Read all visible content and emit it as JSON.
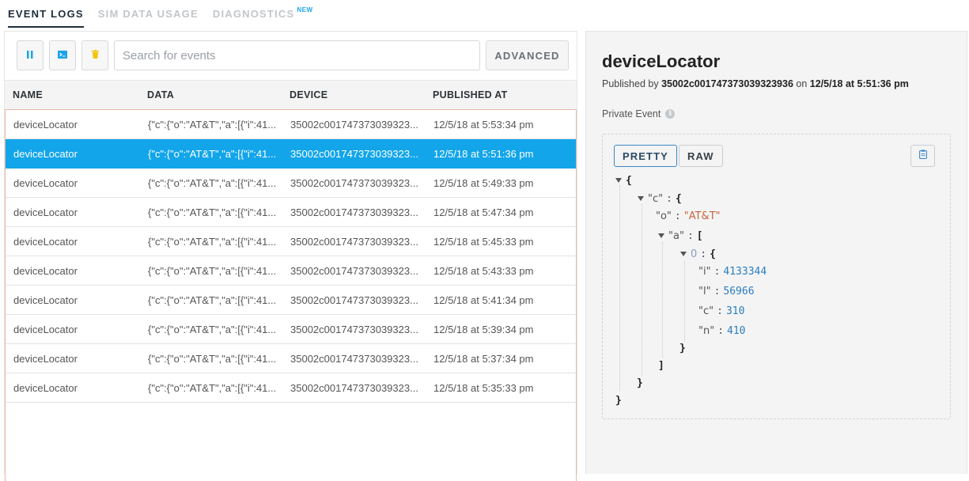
{
  "tabs": [
    {
      "label": "EVENT LOGS",
      "active": true
    },
    {
      "label": "SIM DATA USAGE",
      "active": false
    },
    {
      "label": "DIAGNOSTICS",
      "active": false,
      "badge": "NEW"
    }
  ],
  "toolbar": {
    "pause_icon": "pause-icon",
    "terminal_icon": "terminal-icon",
    "trash_icon": "trash-icon",
    "search_placeholder": "Search for events",
    "search_value": "",
    "advanced_label": "ADVANCED"
  },
  "table": {
    "columns": [
      "NAME",
      "DATA",
      "DEVICE",
      "PUBLISHED AT"
    ],
    "rows": [
      {
        "name": "deviceLocator",
        "data": "{\"c\":{\"o\":\"AT&T\",\"a\":[{\"i\":41...",
        "device": "35002c001747373039323...",
        "published": "12/5/18 at 5:53:34 pm",
        "selected": false
      },
      {
        "name": "deviceLocator",
        "data": "{\"c\":{\"o\":\"AT&T\",\"a\":[{\"i\":41...",
        "device": "35002c001747373039323...",
        "published": "12/5/18 at 5:51:36 pm",
        "selected": true
      },
      {
        "name": "deviceLocator",
        "data": "{\"c\":{\"o\":\"AT&T\",\"a\":[{\"i\":41...",
        "device": "35002c001747373039323...",
        "published": "12/5/18 at 5:49:33 pm",
        "selected": false
      },
      {
        "name": "deviceLocator",
        "data": "{\"c\":{\"o\":\"AT&T\",\"a\":[{\"i\":41...",
        "device": "35002c001747373039323...",
        "published": "12/5/18 at 5:47:34 pm",
        "selected": false
      },
      {
        "name": "deviceLocator",
        "data": "{\"c\":{\"o\":\"AT&T\",\"a\":[{\"i\":41...",
        "device": "35002c001747373039323...",
        "published": "12/5/18 at 5:45:33 pm",
        "selected": false
      },
      {
        "name": "deviceLocator",
        "data": "{\"c\":{\"o\":\"AT&T\",\"a\":[{\"i\":41...",
        "device": "35002c001747373039323...",
        "published": "12/5/18 at 5:43:33 pm",
        "selected": false
      },
      {
        "name": "deviceLocator",
        "data": "{\"c\":{\"o\":\"AT&T\",\"a\":[{\"i\":41...",
        "device": "35002c001747373039323...",
        "published": "12/5/18 at 5:41:34 pm",
        "selected": false
      },
      {
        "name": "deviceLocator",
        "data": "{\"c\":{\"o\":\"AT&T\",\"a\":[{\"i\":41...",
        "device": "35002c001747373039323...",
        "published": "12/5/18 at 5:39:34 pm",
        "selected": false
      },
      {
        "name": "deviceLocator",
        "data": "{\"c\":{\"o\":\"AT&T\",\"a\":[{\"i\":41...",
        "device": "35002c001747373039323...",
        "published": "12/5/18 at 5:37:34 pm",
        "selected": false
      },
      {
        "name": "deviceLocator",
        "data": "{\"c\":{\"o\":\"AT&T\",\"a\":[{\"i\":41...",
        "device": "35002c001747373039323...",
        "published": "12/5/18 at 5:35:33 pm",
        "selected": false
      }
    ]
  },
  "detail": {
    "title": "deviceLocator",
    "published_prefix": "Published by ",
    "device_id": "35002c001747373039323936",
    "on_word": " on ",
    "published_at": "12/5/18 at 5:51:36 pm",
    "private_label": "Private Event",
    "info_icon": "info-icon",
    "pretty_label": "PRETTY",
    "raw_label": "RAW",
    "copy_icon": "clipboard-icon",
    "json": {
      "open_root": "{",
      "key_c": "\"c\"",
      "open_c": "{",
      "key_o": "\"o\"",
      "val_o": "\"AT&T\"",
      "key_a": "\"a\"",
      "open_a": "[",
      "idx_0": "0",
      "open_0": "{",
      "key_i": "\"i\"",
      "val_i": "4133344",
      "key_l": "\"l\"",
      "val_l": "56966",
      "key_c2": "\"c\"",
      "val_c2": "310",
      "key_n": "\"n\"",
      "val_n": "410",
      "close_0": "}",
      "close_a": "]",
      "close_c": "}",
      "close_root": "}"
    }
  },
  "colors": {
    "selected_row": "#12a5ea",
    "accent_new": "#1aa3e8",
    "json_string": "#c8643c",
    "json_number": "#2a7dbf",
    "copy_icon": "#3a88c8",
    "trash_icon": "#f2c40c"
  }
}
